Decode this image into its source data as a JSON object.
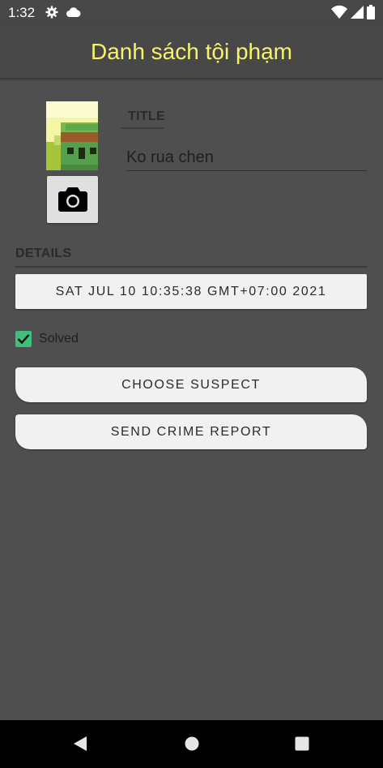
{
  "status_bar": {
    "time": "1:32",
    "left_icons": [
      "gear-icon",
      "cloud-icon"
    ],
    "right_icons": [
      "wifi-icon",
      "signal-icon",
      "battery-icon"
    ]
  },
  "app_bar": {
    "title": "Danh sách tội phạm",
    "title_color": "#f7f36a"
  },
  "crime": {
    "thumbnail": "crime-photo-thumbnail",
    "camera_icon": "camera-icon",
    "title_label": "TITLE",
    "title_value": "Ko rua chen",
    "details_label": "DETAILS",
    "date_label": "SAT JUL 10 10:35:38 GMT+07:00 2021",
    "solved_label": "Solved",
    "solved_checked": true,
    "suspect_label": "CHOOSE SUSPECT",
    "report_label": "SEND CRIME REPORT",
    "accent_color": "#3ec07a"
  },
  "nav_bar": {
    "icons": [
      "back-icon",
      "home-icon",
      "recents-icon"
    ]
  }
}
